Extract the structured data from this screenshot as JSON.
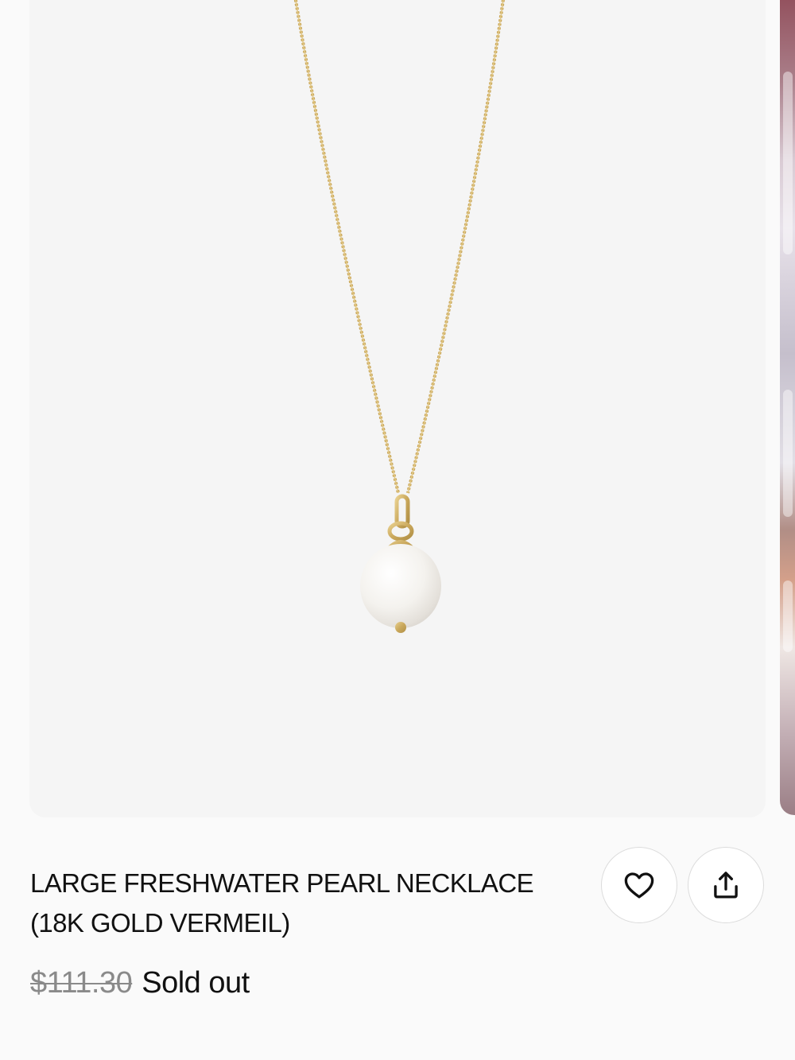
{
  "product": {
    "title": "LARGE FRESHWATER PEARL NECKLACE (18K GOLD VERMEIL)",
    "original_price": "$111.30",
    "status": "Sold out"
  },
  "actions": {
    "favorite_icon": "heart-icon",
    "share_icon": "share-icon"
  },
  "colors": {
    "gold": "#d2b36a",
    "pearl": "#f3f1ec",
    "image_background": "#f5f5f5",
    "text": "#111111",
    "muted_price": "#8a8a8a"
  }
}
